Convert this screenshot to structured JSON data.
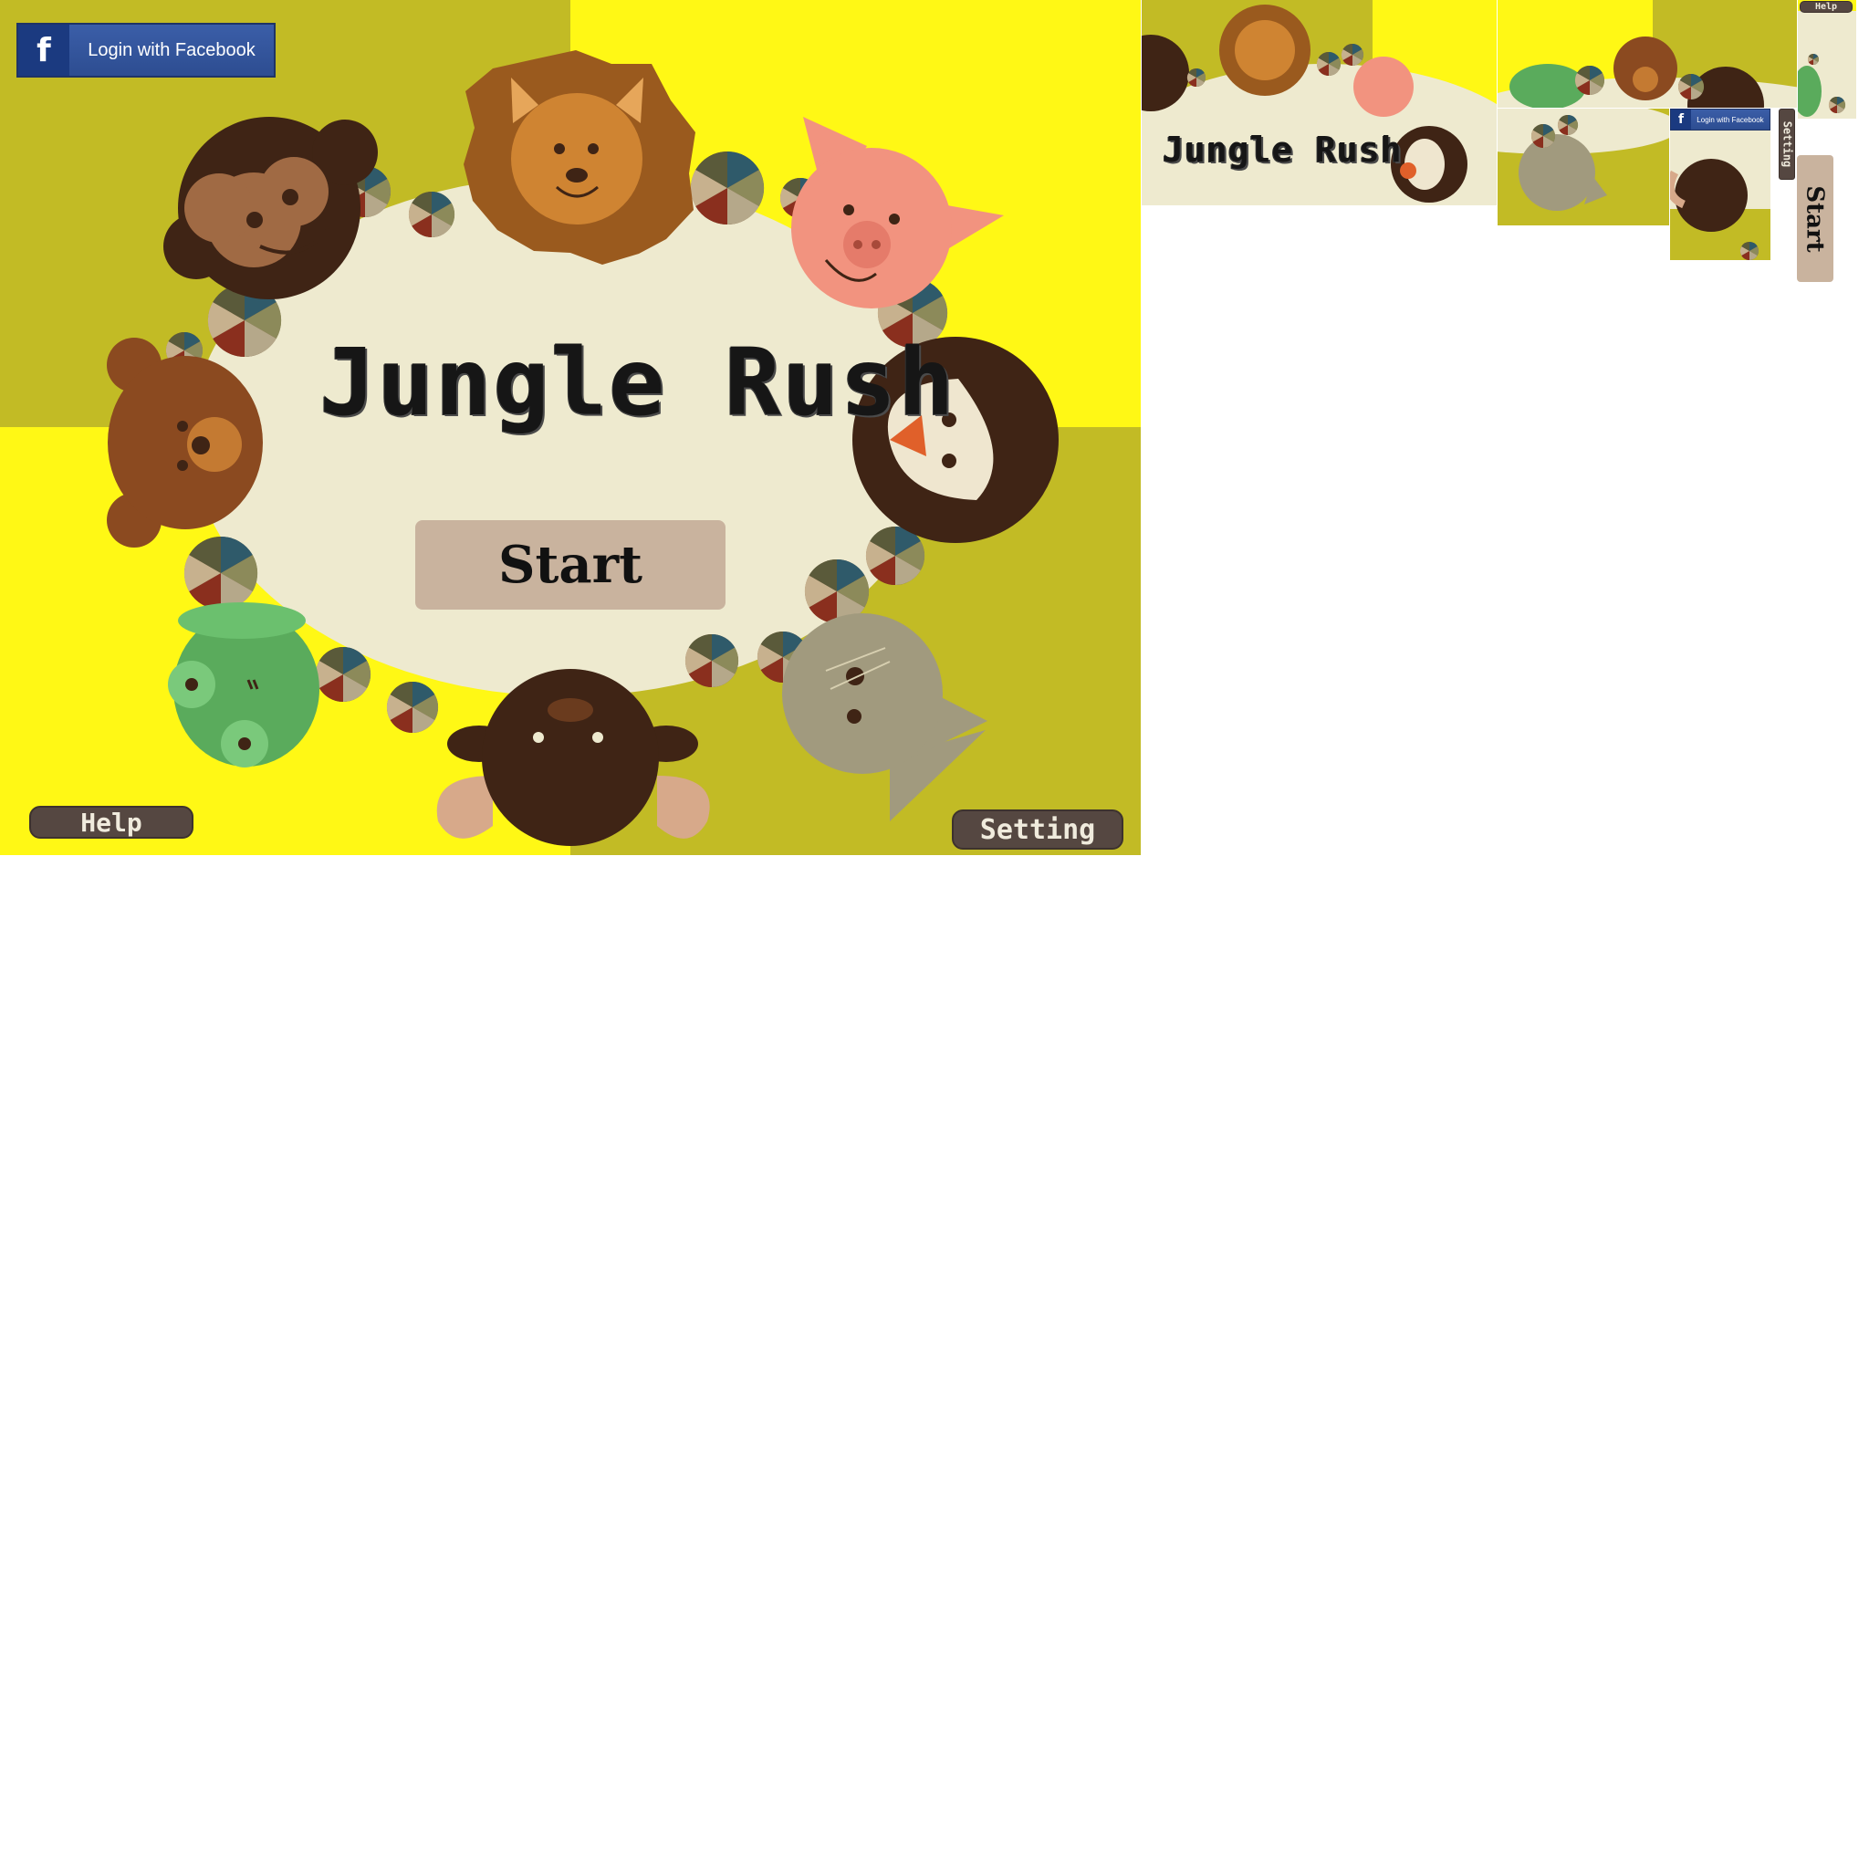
{
  "colors": {
    "olive": "#c2bb25",
    "yellow": "#fff815",
    "oval": "#eeeacf",
    "facebook_blue": "#3b5ea8",
    "button_dark": "#554741",
    "start_button": "#c9b39e"
  },
  "main": {
    "title": "Jungle Rush",
    "start_label": "Start",
    "help_label": "Help",
    "setting_label": "Setting",
    "facebook_label": "Login with Facebook",
    "facebook_icon": "f"
  },
  "sprites": {
    "title_strip_text": "Jungle Rush",
    "small_facebook_label": "Login with Facebook",
    "small_facebook_icon": "f",
    "vertical_setting_label": "Setting",
    "vertical_help_label": "Help",
    "vertical_start_label": "Start"
  },
  "icons": [
    "facebook-icon",
    "monkey-icon",
    "lion-icon",
    "pig-icon",
    "bear-icon",
    "penguin-icon",
    "frog-icon",
    "bull-icon",
    "cat-icon",
    "candy-ball-icon"
  ]
}
